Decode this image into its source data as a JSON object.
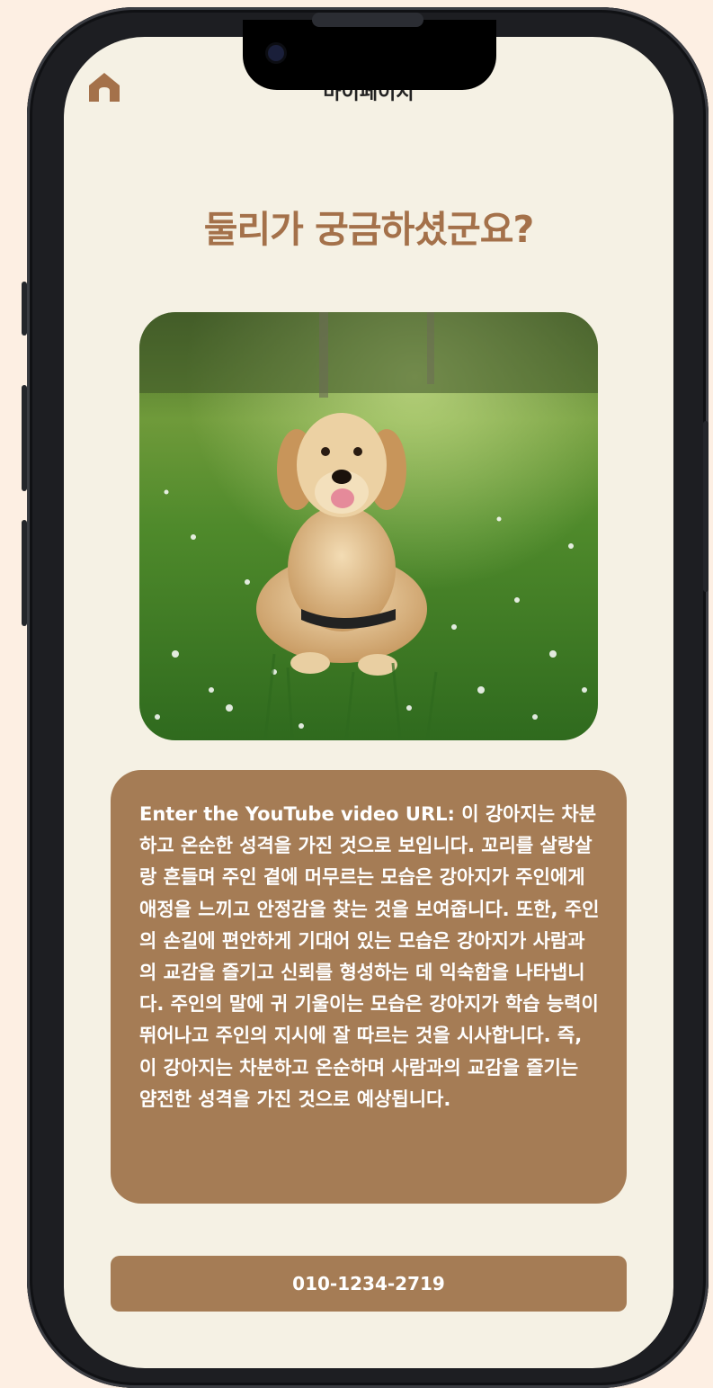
{
  "header": {
    "title": "마이페이지",
    "home_icon": "home-icon"
  },
  "main": {
    "title": "둘리가 궁금하셨군요?",
    "photo": "golden retriever lying in grass field with white flowers",
    "description": "Enter the YouTube video URL: 이 강아지는 차분하고 온순한 성격을 가진 것으로 보입니다. 꼬리를 살랑살랑 흔들며 주인 곁에 머무르는 모습은 강아지가 주인에게 애정을 느끼고 안정감을 찾는 것을 보여줍니다. 또한, 주인의 손길에 편안하게 기대어 있는 모습은 강아지가 사람과의 교감을 즐기고 신뢰를 형성하는 데 익숙함을 나타냅니다. 주인의 말에 귀 기울이는 모습은 강아지가 학습 능력이 뛰어나고 주인의 지시에 잘 따르는 것을 시사합니다. 즉, 이 강아지는 차분하고 온순하며 사람과의 교감을 즐기는 얌전한 성격을 가진 것으로 예상됩니다.",
    "phone_number": "010-1234-2719"
  },
  "colors": {
    "accent": "#a57c55",
    "title": "#a4714a",
    "screen_bg": "#f5f1e4",
    "page_bg": "#fdefe3"
  }
}
